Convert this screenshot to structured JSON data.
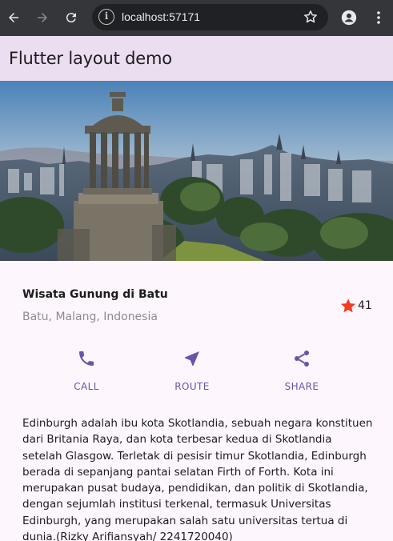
{
  "browser": {
    "url": "localhost:57171",
    "back_icon": "arrow-left-icon",
    "forward_icon": "arrow-right-icon",
    "reload_icon": "reload-icon"
  },
  "app": {
    "title": "Flutter layout demo"
  },
  "place": {
    "title": "Wisata Gunung di Batu",
    "location": "Batu, Malang, Indonesia",
    "rating": "41"
  },
  "actions": [
    {
      "label": "CALL",
      "icon": "phone-icon"
    },
    {
      "label": "ROUTE",
      "icon": "near-me-icon"
    },
    {
      "label": "SHARE",
      "icon": "share-icon"
    }
  ],
  "description": "Edinburgh adalah ibu kota Skotlandia, sebuah negara konstituen dari Britania Raya, dan kota terbesar kedua di Skotlandia setelah Glasgow. Terletak di pesisir timur Skotlandia, Edinburgh berada di sepanjang pantai selatan Firth of Forth. Kota ini merupakan pusat budaya, pendidikan, dan politik di Skotlandia, dengan sejumlah institusi terkenal, termasuk Universitas Edinburgh, yang merupakan salah satu universitas tertua di dunia.(Rizky Arifiansyah/ 2241720040)",
  "colors": {
    "accent": "#6b53a8",
    "star": "#f43b1f",
    "appbar": "#ebdef0"
  }
}
